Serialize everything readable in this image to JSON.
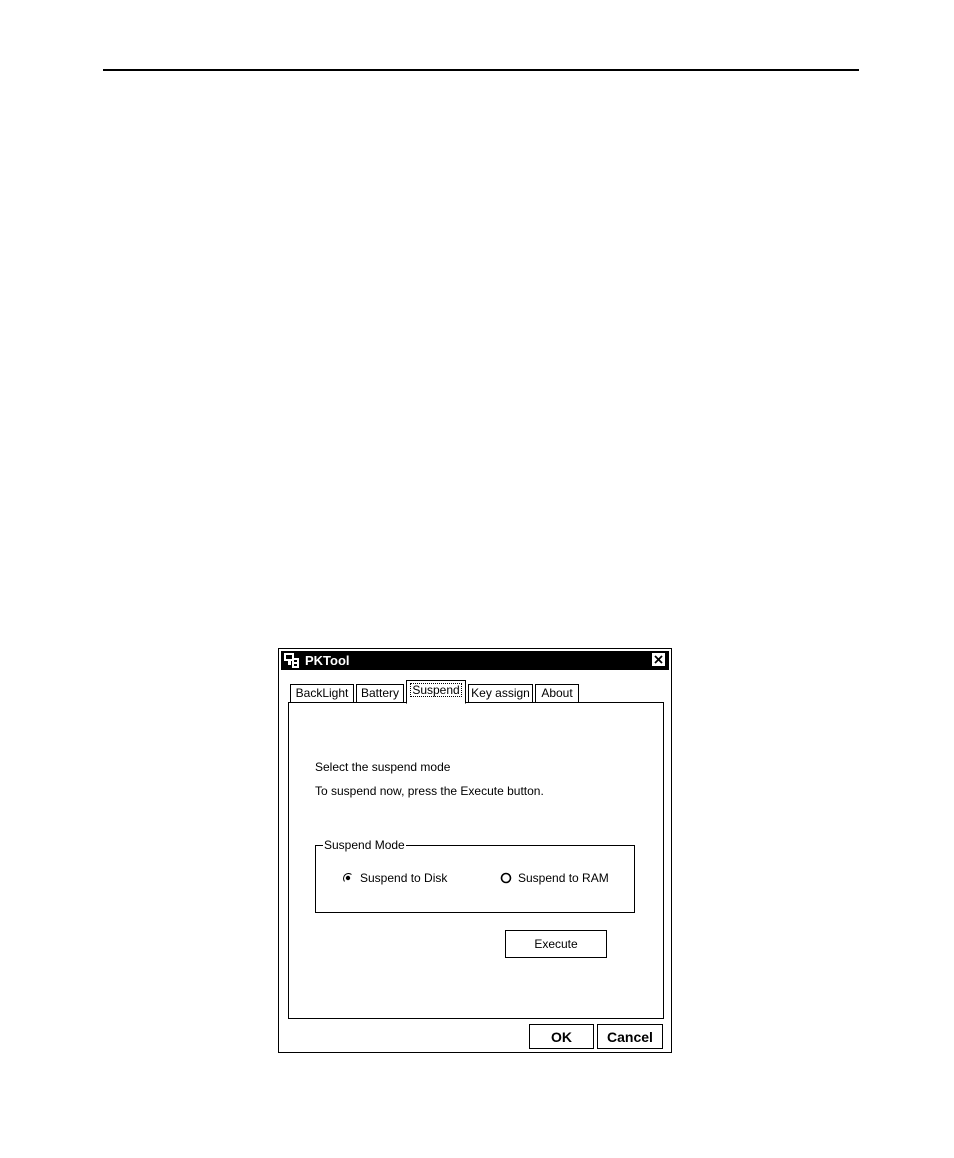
{
  "window": {
    "title": "PKTool",
    "icon": "pktool-app-icon",
    "close_icon": "close-icon"
  },
  "tabs": [
    {
      "label": "BackLight",
      "active": false
    },
    {
      "label": "Battery",
      "active": false
    },
    {
      "label": "Suspend",
      "active": true
    },
    {
      "label": "Key assign",
      "active": false
    },
    {
      "label": "About",
      "active": false
    }
  ],
  "suspend": {
    "instruction_1": "Select the suspend mode",
    "instruction_2": "To suspend now, press the Execute button.",
    "group_label": "Suspend Mode",
    "options": [
      {
        "label": "Suspend to Disk",
        "selected": true
      },
      {
        "label": "Suspend to RAM",
        "selected": false
      }
    ],
    "execute_label": "Execute"
  },
  "footer": {
    "ok_label": "OK",
    "cancel_label": "Cancel"
  }
}
